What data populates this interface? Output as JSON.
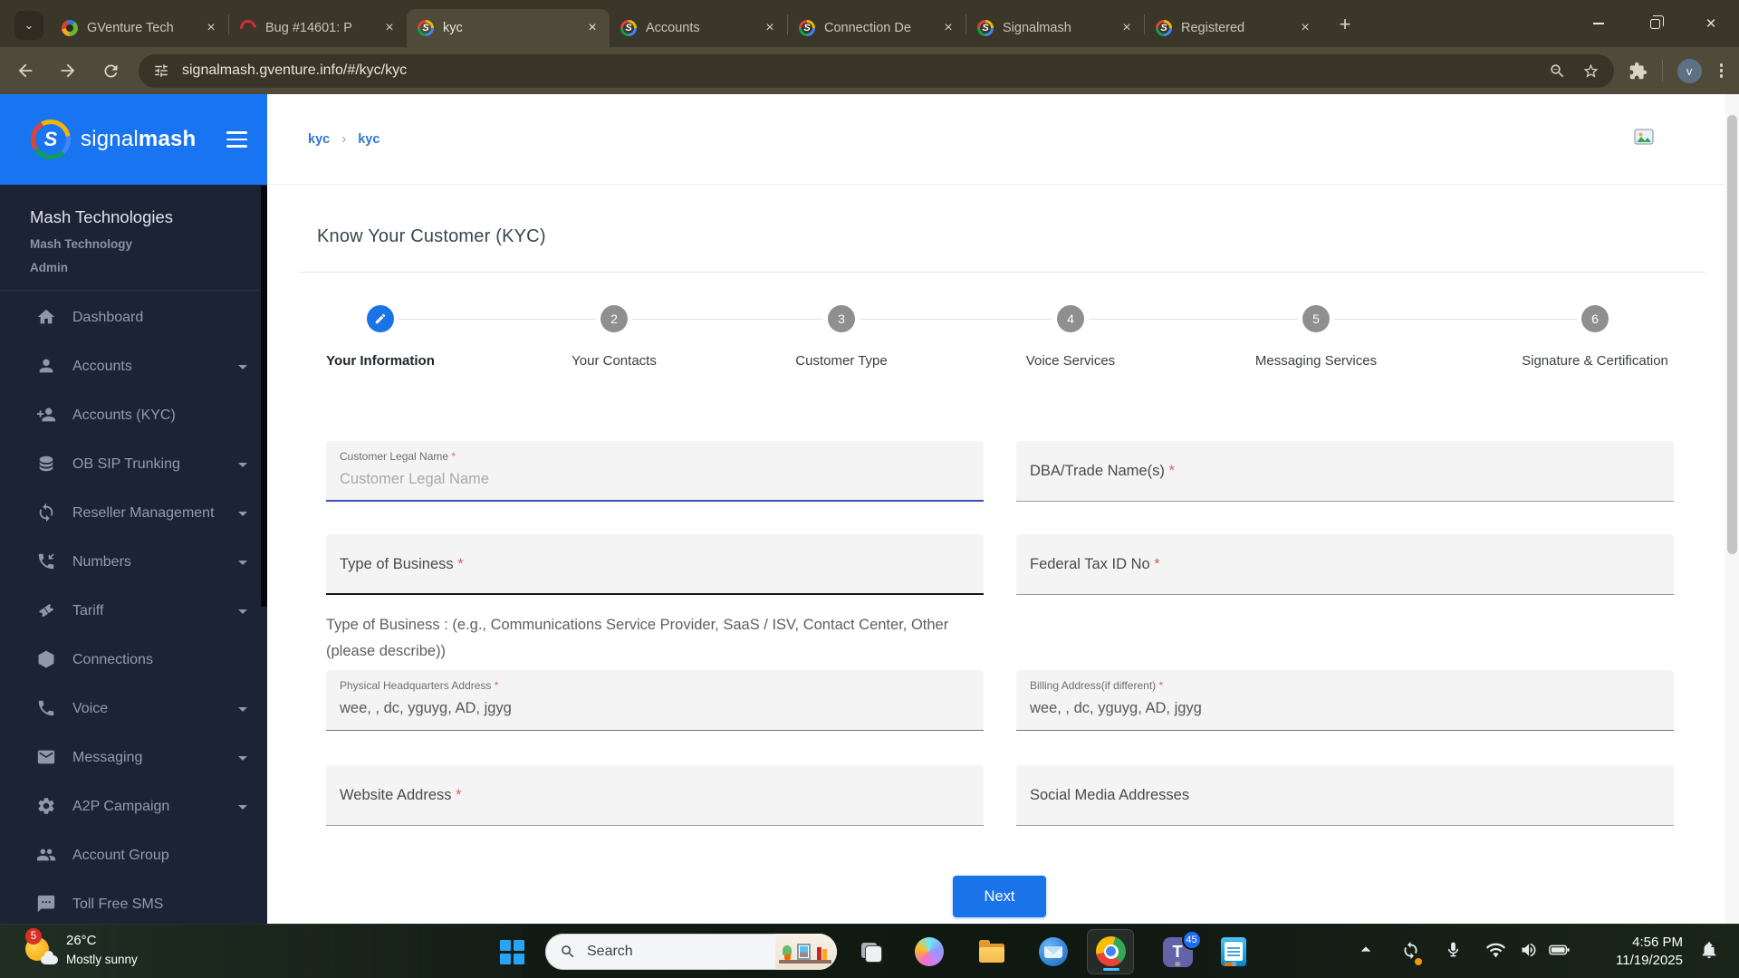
{
  "colors": {
    "accent_blue": "#1a73e8",
    "header_blue": "#1974f2",
    "sidebar_bg": "#1b2334",
    "required_red": "#e25d5d"
  },
  "browser": {
    "tabs": [
      {
        "title": "GVenture Tech",
        "favicon": "gventure-favicon"
      },
      {
        "title": "Bug #14601: P",
        "favicon": "redmine-favicon"
      },
      {
        "title": "kyc",
        "favicon": "signalmash-favicon",
        "active": true
      },
      {
        "title": "Accounts",
        "favicon": "signalmash-favicon"
      },
      {
        "title": "Connection De",
        "favicon": "signalmash-favicon"
      },
      {
        "title": "Signalmash",
        "favicon": "signalmash-favicon"
      },
      {
        "title": "Registered",
        "favicon": "signalmash-favicon"
      }
    ],
    "url": "signalmash.gventure.info/#/kyc/kyc",
    "avatar": "v"
  },
  "sidebar": {
    "brand_signal": "signal",
    "brand_mash": "mash",
    "org_name": "Mash Technologies",
    "org_sub": "Mash Technology",
    "org_role": "Admin",
    "items": [
      {
        "label": "Dashboard",
        "icon": "home-icon",
        "expandable": false
      },
      {
        "label": "Accounts",
        "icon": "person-icon",
        "expandable": true
      },
      {
        "label": "Accounts (KYC)",
        "icon": "person-add-icon",
        "expandable": false
      },
      {
        "label": "OB SIP Trunking",
        "icon": "database-icon",
        "expandable": true
      },
      {
        "label": "Reseller Management",
        "icon": "sync-icon",
        "expandable": true
      },
      {
        "label": "Numbers",
        "icon": "call-received-icon",
        "expandable": true
      },
      {
        "label": "Tariff",
        "icon": "ticket-icon",
        "expandable": true
      },
      {
        "label": "Connections",
        "icon": "hexagon-globe-icon",
        "expandable": false
      },
      {
        "label": "Voice",
        "icon": "phone-icon",
        "expandable": true
      },
      {
        "label": "Messaging",
        "icon": "mail-icon",
        "expandable": true
      },
      {
        "label": "A2P Campaign",
        "icon": "gear-icon",
        "expandable": true
      },
      {
        "label": "Account Group",
        "icon": "people-icon",
        "expandable": false
      },
      {
        "label": "Toll Free SMS",
        "icon": "sms-icon",
        "expandable": false
      }
    ]
  },
  "breadcrumb": {
    "first": "kyc",
    "second": "kyc"
  },
  "main": {
    "title": "Know Your Customer (KYC)",
    "stepper": [
      {
        "num": "1",
        "label": "Your Information",
        "active": true
      },
      {
        "num": "2",
        "label": "Your Contacts"
      },
      {
        "num": "3",
        "label": "Customer Type"
      },
      {
        "num": "4",
        "label": "Voice Services"
      },
      {
        "num": "5",
        "label": "Messaging Services"
      },
      {
        "num": "6",
        "label": "Signature & Certification"
      }
    ]
  },
  "form": {
    "customer_legal_name": {
      "label": "Customer Legal Name",
      "required": "*",
      "placeholder": "Customer Legal Name"
    },
    "dba_trade_name": {
      "label": "DBA/Trade Name(s)",
      "required": "*"
    },
    "type_of_business": {
      "label": "Type of Business",
      "required": "*"
    },
    "federal_tax_id": {
      "label": "Federal Tax ID No",
      "required": "*"
    },
    "type_of_business_helper": "Type of Business : (e.g., Communications Service Provider, SaaS / ISV, Contact Center, Other (please describe))",
    "physical_hq_address": {
      "label": "Physical Headquarters Address",
      "required": "*",
      "value": "wee, , dc, yguyg, AD, jgyg"
    },
    "billing_address": {
      "label": "Billing Address(if different)",
      "required": "*",
      "value": "wee, , dc, yguyg, AD, jgyg"
    },
    "website_address": {
      "label": "Website Address",
      "required": "*"
    },
    "social_media": {
      "label": "Social Media Addresses"
    },
    "next_label": "Next"
  },
  "taskbar": {
    "weather": {
      "badge": "5",
      "temp": "26°C",
      "condition": "Mostly sunny"
    },
    "search_placeholder": "Search",
    "teams_badge": "45",
    "clock_time": "4:56 PM",
    "clock_date": "11/19/2025"
  }
}
